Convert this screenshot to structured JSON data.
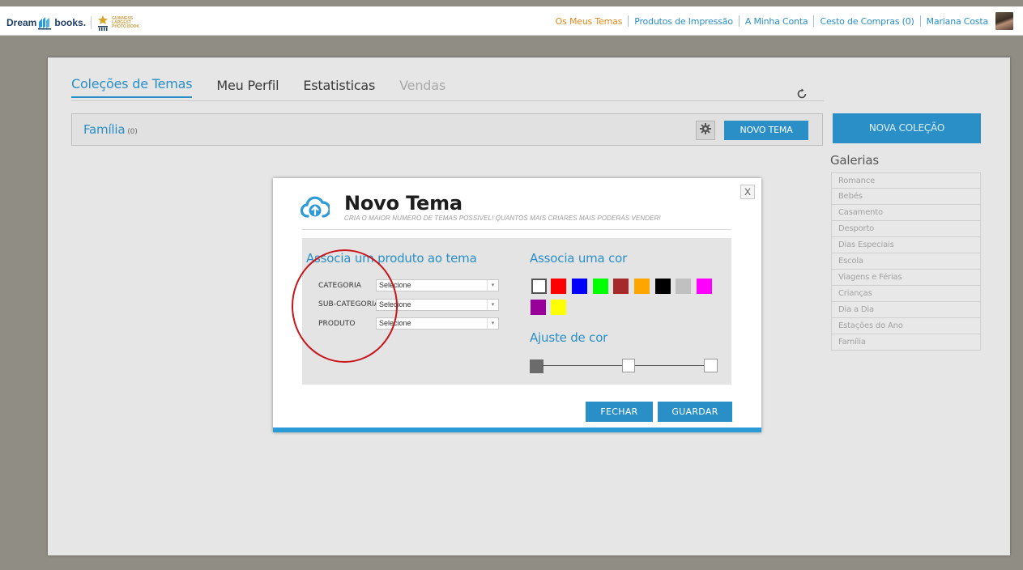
{
  "brand": {
    "logo_left": "Dream",
    "logo_right": "books.",
    "guinness": [
      "GUINNESS",
      "LARGEST",
      "PHOTO BOOK"
    ]
  },
  "topnav": {
    "items": [
      {
        "label": "Os Meus Temas",
        "active": true
      },
      {
        "label": "Produtos de Impressão",
        "active": false
      },
      {
        "label": "A Minha Conta",
        "active": false
      },
      {
        "label": "Cesto de Compras (0)",
        "active": false
      },
      {
        "label": "Mariana Costa",
        "active": false
      }
    ]
  },
  "tabs": [
    {
      "label": "Coleções de Temas",
      "state": "active"
    },
    {
      "label": "Meu Perfil",
      "state": "normal"
    },
    {
      "label": "Estatisticas",
      "state": "normal"
    },
    {
      "label": "Vendas",
      "state": "disabled"
    }
  ],
  "collection": {
    "name": "Família",
    "count": "(0)",
    "new_theme_label": "NOVO TEMA"
  },
  "sidebar": {
    "new_collection_label": "NOVA COLEÇÃO",
    "galleries_title": "Galerias",
    "galleries": [
      "Romance",
      "Bebés",
      "Casamento",
      "Desporto",
      "Dias Especiais",
      "Escola",
      "Viagens e Férias",
      "Crianças",
      "Dia a Dia",
      "Estações do Ano",
      "Família"
    ]
  },
  "modal": {
    "close_label": "X",
    "title": "Novo Tema",
    "subtitle": "CRIA O MAIOR NUMERO DE TEMAS POSSIVEL! QUANTOS MAIS CRIARES MAIS PODERÁS VENDER!",
    "product_section_title": "Associa um produto ao tema",
    "fields": [
      {
        "label": "CATEGORIA",
        "value": "Selecione"
      },
      {
        "label": "SUB-CATEGORIA",
        "value": "Selecione"
      },
      {
        "label": "PRODUTO",
        "value": "Selecione"
      }
    ],
    "color_section_title": "Associa uma cor",
    "colors": [
      "#ffffff",
      "#ff0000",
      "#0000ff",
      "#00ff00",
      "#a52a2a",
      "#ffa500",
      "#000000",
      "#c0c0c0",
      "#ff00ff",
      "#990099",
      "#ffff00"
    ],
    "selected_color": "#ffffff",
    "adjust_section_title": "Ajuste de cor",
    "slider_value": 0.5,
    "close_button_label": "FECHAR",
    "save_button_label": "GUARDAR"
  },
  "theme_colors": {
    "accent": "#2a8fc7",
    "active_nav": "#e08a1e",
    "annotation": "#c8141a"
  }
}
